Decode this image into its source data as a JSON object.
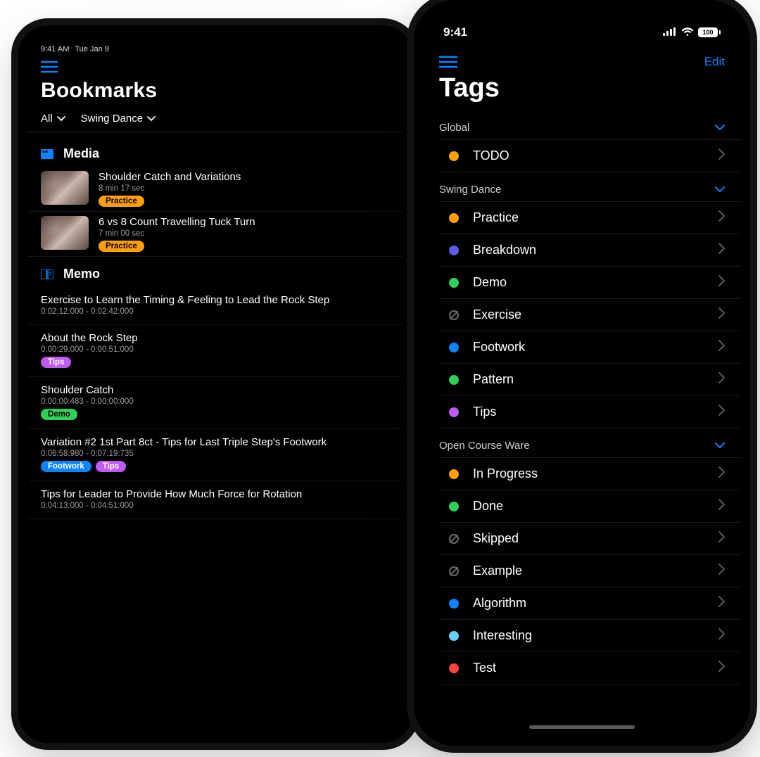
{
  "ipad": {
    "status_time": "9:41 AM",
    "status_date": "Tue Jan 9",
    "page_title": "Bookmarks",
    "filter_all": "All",
    "filter_cat": "Swing Dance",
    "section_media": "Media",
    "section_memo": "Memo",
    "media": [
      {
        "title": "Shoulder Catch and Variations",
        "duration": "8 min 17 sec",
        "tags": [
          {
            "label": "Practice",
            "color": "orange"
          }
        ]
      },
      {
        "title": "6 vs 8 Count Travelling Tuck Turn",
        "duration": "7 min 00 sec",
        "tags": [
          {
            "label": "Practice",
            "color": "orange"
          }
        ]
      }
    ],
    "memo": [
      {
        "title": "Exercise to Learn the Timing & Feeling to Lead the Rock Step",
        "ts": "0:02:12:000 - 0:02:42:000",
        "tags": []
      },
      {
        "title": "About the Rock Step",
        "ts": "0:00:29:000 - 0:00:51:000",
        "tags": [
          {
            "label": "Tips",
            "color": "purple"
          }
        ]
      },
      {
        "title": "Shoulder Catch",
        "ts": "0:00:00:483 - 0:00:00:000",
        "tags": [
          {
            "label": "Demo",
            "color": "green"
          }
        ]
      },
      {
        "title": "Variation #2 1st Part 8ct - Tips for Last Triple Step's Footwork",
        "ts": "0:06:58:980 - 0:07:19:735",
        "tags": [
          {
            "label": "Footwork",
            "color": "blue"
          },
          {
            "label": "Tips",
            "color": "purple"
          }
        ]
      },
      {
        "title": "Tips for Leader to Provide How Much Force for Rotation",
        "ts": "0:04:13:000 - 0:04:51:000",
        "tags": []
      }
    ]
  },
  "iphone": {
    "status_time": "9:41",
    "battery": "100",
    "edit": "Edit",
    "page_title": "Tags",
    "groups": [
      {
        "name": "Global",
        "tags": [
          {
            "label": "TODO",
            "color": "orange"
          }
        ]
      },
      {
        "name": "Swing Dance",
        "tags": [
          {
            "label": "Practice",
            "color": "orange"
          },
          {
            "label": "Breakdown",
            "color": "indigo"
          },
          {
            "label": "Demo",
            "color": "green"
          },
          {
            "label": "Exercise",
            "color": "none"
          },
          {
            "label": "Footwork",
            "color": "blue"
          },
          {
            "label": "Pattern",
            "color": "green"
          },
          {
            "label": "Tips",
            "color": "purple"
          }
        ]
      },
      {
        "name": "Open Course Ware",
        "tags": [
          {
            "label": "In Progress",
            "color": "orange"
          },
          {
            "label": "Done",
            "color": "green"
          },
          {
            "label": "Skipped",
            "color": "none"
          },
          {
            "label": "Example",
            "color": "none"
          },
          {
            "label": "Algorithm",
            "color": "blue"
          },
          {
            "label": "Interesting",
            "color": "cyan"
          },
          {
            "label": "Test",
            "color": "red"
          }
        ]
      }
    ]
  }
}
